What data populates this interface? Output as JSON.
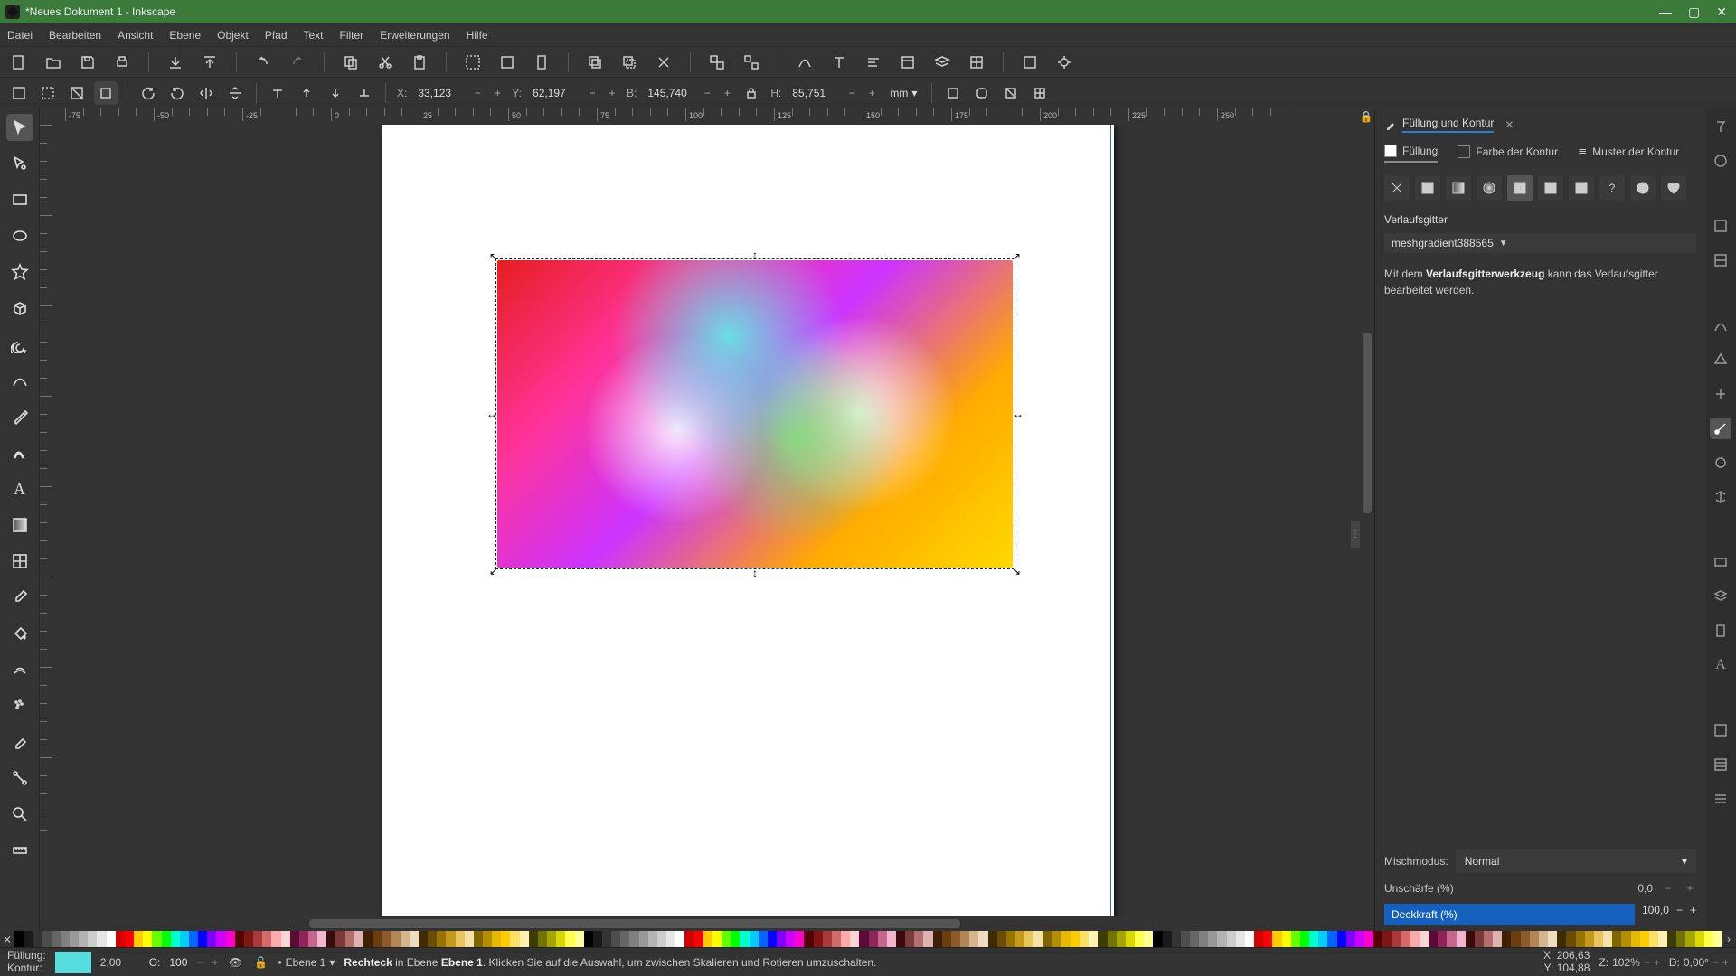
{
  "window": {
    "title": "*Neues Dokument 1 - Inkscape"
  },
  "menu": {
    "items": [
      "Datei",
      "Bearbeiten",
      "Ansicht",
      "Ebene",
      "Objekt",
      "Pfad",
      "Text",
      "Filter",
      "Erweiterungen",
      "Hilfe"
    ]
  },
  "toolbar2": {
    "x_label": "X:",
    "x_value": "33,123",
    "y_label": "Y:",
    "y_value": "62,197",
    "w_label": "B:",
    "w_value": "145,740",
    "h_label": "H:",
    "h_value": "85,751",
    "unit": "mm"
  },
  "ruler": {
    "hlabels": [
      "-75",
      "-50",
      "-25",
      "0",
      "25",
      "50",
      "75",
      "100",
      "125",
      "150",
      "175",
      "200",
      "225",
      "250"
    ]
  },
  "panel": {
    "title": "Füllung und Kontur",
    "tab_fill": "Füllung",
    "tab_stroke_paint": "Farbe der Kontur",
    "tab_stroke_style": "Muster der Kontur",
    "fill_type_label": "Verlaufsgitter",
    "gradient_name": "meshgradient388565",
    "hint_pre": "Mit dem ",
    "hint_bold": "Verlaufsgitterwerkzeug",
    "hint_post": " kann das Verlaufsgitter bearbeitet werden.",
    "blend_label": "Mischmodus:",
    "blend_value": "Normal",
    "blur_label": "Unschärfe (%)",
    "blur_value": "0,0",
    "opacity_label": "Deckkraft (%)",
    "opacity_value": "100,0"
  },
  "status": {
    "fill_label": "Füllung:",
    "stroke_label": "Kontur:",
    "stroke_width": "2,00",
    "o_label": "O:",
    "o_value": "100",
    "layer_label": "Ebene 1",
    "msg_type": "Rechteck",
    "msg_mid1": " in Ebene ",
    "msg_layer": "Ebene 1",
    "msg_rest": ". Klicken Sie auf die Auswahl, um zwischen Skalieren und Rotieren umzuschalten.",
    "coord_x_label": "X:",
    "coord_x": "206,63",
    "coord_y_label": "Y:",
    "coord_y": "104,88",
    "zoom_label": "Z:",
    "zoom_value": "102%",
    "rot_label": "D:",
    "rot_value": "0,00°"
  },
  "palette_grays": [
    "#000000",
    "#1a1a1a",
    "#333333",
    "#4d4d4d",
    "#666666",
    "#808080",
    "#999999",
    "#b3b3b3",
    "#cccccc",
    "#e6e6e6",
    "#ffffff"
  ],
  "palette_primary": [
    "#d40000",
    "#ff0000",
    "#ffcc00",
    "#ffff00",
    "#66ff00",
    "#00ff00",
    "#00ffcc",
    "#00ccff",
    "#0066ff",
    "#0000ff",
    "#7f00ff",
    "#cc00ff",
    "#ff00cc"
  ],
  "palette_reds": [
    "#550000",
    "#801515",
    "#aa3939",
    "#d46a6a",
    "#ffaaaa",
    "#ffd4d4",
    "#5c0b36",
    "#8e2458",
    "#c8658c",
    "#efb6cd",
    "#3a0b0b",
    "#7b3a3a",
    "#b46e6e",
    "#e0b3b3"
  ],
  "palette_browns": [
    "#402000",
    "#6b3e10",
    "#8c5a2b",
    "#b38755",
    "#d4b58c",
    "#efdbbd",
    "#3e2c00",
    "#6a4d00",
    "#997300",
    "#c49a1a",
    "#e8c55c",
    "#f5e3a6"
  ],
  "palette_yellows": [
    "#806600",
    "#b38f00",
    "#e6b800",
    "#ffcc00",
    "#ffe066",
    "#fff2b3",
    "#3d3d00",
    "#737300",
    "#a6a600",
    "#d9d900",
    "#ffff4d",
    "#ffff99"
  ]
}
